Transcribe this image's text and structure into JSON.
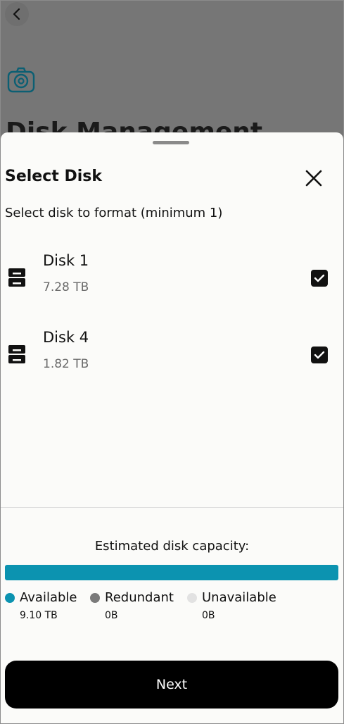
{
  "background": {
    "page_title": "Disk Management"
  },
  "sheet": {
    "title": "Select Disk",
    "subtitle": "Select disk to format (minimum 1)",
    "disks": [
      {
        "name": "Disk 1",
        "size": "7.28 TB",
        "checked": true
      },
      {
        "name": "Disk 4",
        "size": "1.82 TB",
        "checked": true
      }
    ]
  },
  "capacity": {
    "title": "Estimated disk capacity:",
    "available_fraction": 1.0,
    "legend": [
      {
        "label": "Available",
        "value": "9.10 TB",
        "color": "#0c93b0"
      },
      {
        "label": "Redundant",
        "value": "0B",
        "color": "#7a7a7a"
      },
      {
        "label": "Unavailable",
        "value": "0B",
        "color": "#e2e2e2"
      }
    ]
  },
  "footer": {
    "next_label": "Next"
  },
  "icons": {
    "back": "chevron-left-icon",
    "settings": "gear-icon",
    "close": "close-icon",
    "disk": "disk-drive-icon",
    "checkbox": "checkbox-checked-icon"
  }
}
